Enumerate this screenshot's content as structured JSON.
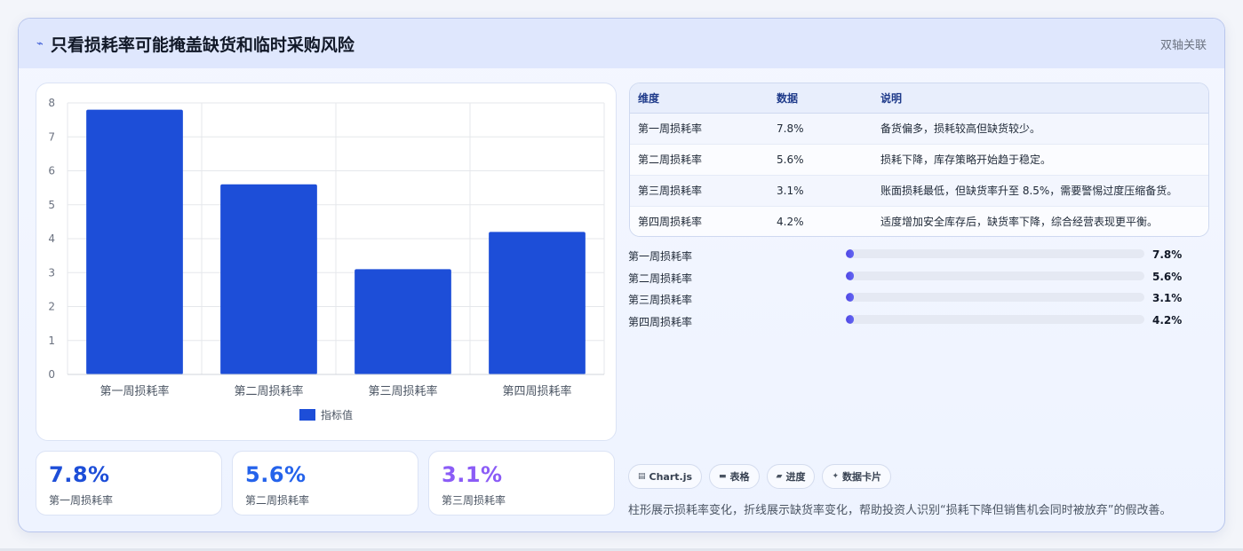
{
  "header": {
    "icon": "trend-line-icon",
    "title": "只看损耗率可能掩盖缺货和临时采购风险",
    "tag": "双轴关联"
  },
  "chart_data": {
    "type": "bar",
    "categories": [
      "第一周损耗率",
      "第二周损耗率",
      "第三周损耗率",
      "第四周损耗率"
    ],
    "series": [
      {
        "name": "指标值",
        "values": [
          7.8,
          5.6,
          3.1,
          4.2
        ],
        "color": "#1d4ed8"
      }
    ],
    "y_ticks": [
      "0",
      "1",
      "2",
      "3",
      "4",
      "5",
      "6",
      "7",
      "8"
    ],
    "ylim": [
      0,
      8
    ],
    "grid": true,
    "legend": "bottom"
  },
  "stats": [
    {
      "value": "7.8%",
      "label": "第一周损耗率",
      "color": "#1d4ed8"
    },
    {
      "value": "5.6%",
      "label": "第二周损耗率",
      "color": "#2563eb"
    },
    {
      "value": "3.1%",
      "label": "第三周损耗率",
      "color": "#8b5cf6"
    }
  ],
  "table": {
    "headers": [
      "维度",
      "数据",
      "说明"
    ],
    "rows": [
      [
        "第一周损耗率",
        "7.8%",
        "备货偏多，损耗较高但缺货较少。"
      ],
      [
        "第二周损耗率",
        "5.6%",
        "损耗下降，库存策略开始趋于稳定。"
      ],
      [
        "第三周损耗率",
        "3.1%",
        "账面损耗最低，但缺货率升至 8.5%，需要警惕过度压缩备货。"
      ],
      [
        "第四周损耗率",
        "4.2%",
        "适度增加安全库存后，缺货率下降，综合经营表现更平衡。"
      ]
    ]
  },
  "progress": [
    {
      "label": "第一周损耗率",
      "value": "7.8%",
      "fill": 0.026
    },
    {
      "label": "第二周损耗率",
      "value": "5.6%",
      "fill": 0.026
    },
    {
      "label": "第三周损耗率",
      "value": "3.1%",
      "fill": 0.026
    },
    {
      "label": "第四周损耗率",
      "value": "4.2%",
      "fill": 0.026
    }
  ],
  "tags": [
    {
      "icon": "chart-icon",
      "label": "Chart.js"
    },
    {
      "icon": "table-icon",
      "label": "表格"
    },
    {
      "icon": "progress-icon",
      "label": "进度"
    },
    {
      "icon": "sparkle-icon",
      "label": "数据卡片"
    }
  ],
  "note": "柱形展示损耗率变化，折线展示缺货率变化，帮助投资人识别“损耗下降但销售机会同时被放弃”的假改善。"
}
